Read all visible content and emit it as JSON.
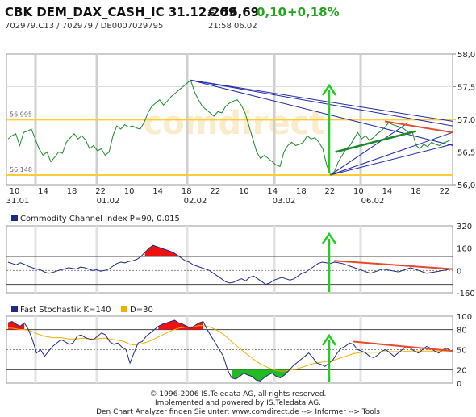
{
  "header": {
    "title": "CBK DEM_DAX_CASH_IC 31.12.209",
    "price": "€ 56,69",
    "change": "0,10",
    "change_pct": "+0,18%",
    "ids": "702979.C13  /  702979  /  DE0007029795",
    "time": "21:58   06.02"
  },
  "watermark": "comdirect",
  "footer": {
    "line1": "© 1996-2006 IS.Teledata AG, all rights reserved.",
    "line2": "Implemented and powered by IS.Teledata AG.",
    "line3": "Den Chart Analyzer finden Sie unter: www.comdirect.de --> Informer --> Tools"
  },
  "colors": {
    "price_line": "#1a8a2a",
    "trend_blue": "#1f2aa8",
    "trend_red": "#e64a2a",
    "support_orange": "#ffcc33",
    "arrow_green": "#22cc22",
    "fill_red": "#ee1111",
    "fill_green": "#22bb22",
    "indicator_line": "#1e2b82",
    "signal_line": "#f0b000"
  },
  "chart_data": [
    {
      "type": "line",
      "title": "",
      "ylim": [
        56.0,
        58.0
      ],
      "yticks": [
        "58,0",
        "57,5",
        "57,0",
        "56,5",
        "56,0"
      ],
      "x_ticks_top": [
        "10",
        "14",
        "18",
        "22",
        "10",
        "14",
        "18",
        "22",
        "10",
        "14",
        "18",
        "22",
        "10",
        "14",
        "18",
        "22"
      ],
      "x_ticks_bottom": [
        "31.01",
        "01.02",
        "02.02",
        "03.02",
        "06.02"
      ],
      "support_lines": [
        {
          "label": "56,995",
          "value": 56.995
        },
        {
          "label": "56,148",
          "value": 56.148
        }
      ],
      "series": [
        {
          "values": [
            56.7,
            56.75,
            56.78,
            56.6,
            56.8,
            56.82,
            56.85,
            56.7,
            56.55,
            56.45,
            56.5,
            56.35,
            56.42,
            56.5,
            56.48,
            56.65,
            56.72,
            56.78,
            56.7,
            56.75,
            56.68,
            56.55,
            56.6,
            56.52,
            56.55,
            56.45,
            56.5,
            56.75,
            56.9,
            56.85,
            56.92,
            56.88,
            56.9,
            56.87,
            56.85,
            56.95,
            57.1,
            57.2,
            57.25,
            57.3,
            57.22,
            57.28,
            57.35,
            57.4,
            57.45,
            57.5,
            57.55,
            57.6,
            57.42,
            57.3,
            57.2,
            57.15,
            57.1,
            57.05,
            57.12,
            57.1,
            57.2,
            57.25,
            57.28,
            57.3,
            57.22,
            57.1,
            56.9,
            56.7,
            56.5,
            56.4,
            56.45,
            56.4,
            56.35,
            56.3,
            56.28,
            56.5,
            56.6,
            56.65,
            56.6,
            56.62,
            56.65,
            56.75,
            56.7,
            56.72,
            56.65,
            56.55,
            56.3,
            56.15,
            56.2,
            56.35,
            56.45,
            56.55,
            56.6,
            56.7,
            56.8,
            56.7,
            56.75,
            56.68,
            56.72,
            56.78,
            56.82,
            56.88,
            56.95,
            56.92,
            56.9,
            56.88,
            56.85,
            56.8,
            56.82,
            56.6,
            56.55,
            56.62,
            56.58,
            56.65,
            56.62,
            56.6,
            56.64,
            56.66,
            56.69
          ]
        }
      ]
    },
    {
      "type": "line",
      "title": "Commodity Channel Index P=90, 0.015",
      "ylim": [
        -160,
        320
      ],
      "yticks": [
        "320",
        "160",
        "0",
        "-160"
      ],
      "series": [
        {
          "values": [
            60,
            50,
            40,
            55,
            45,
            30,
            20,
            10,
            5,
            -10,
            -20,
            -15,
            -5,
            5,
            10,
            20,
            15,
            10,
            25,
            20,
            10,
            0,
            5,
            -5,
            0,
            10,
            30,
            50,
            60,
            55,
            65,
            70,
            80,
            100,
            130,
            160,
            180,
            170,
            160,
            150,
            140,
            130,
            110,
            90,
            70,
            60,
            40,
            30,
            20,
            10,
            0,
            -20,
            -40,
            -60,
            -80,
            -90,
            -85,
            -70,
            -60,
            -75,
            -50,
            -40,
            -60,
            -80,
            -100,
            -90,
            -70,
            -60,
            -50,
            -60,
            -70,
            -60,
            -40,
            -20,
            -10,
            10,
            30,
            50,
            60,
            55,
            50,
            60,
            55,
            50,
            40,
            30,
            20,
            10,
            0,
            -10,
            -20,
            -10,
            0,
            10,
            5,
            0,
            -5,
            -10,
            0,
            10,
            20,
            10,
            0,
            -10,
            -20,
            -15,
            -10,
            -5,
            0,
            5,
            10
          ]
        }
      ]
    },
    {
      "type": "line",
      "title": "Fast Stochastik K=140",
      "legend": [
        "Fast Stochastik K=140",
        "D=30"
      ],
      "ylim": [
        0,
        100
      ],
      "yticks": [
        "100",
        "80",
        "50",
        "20",
        "0"
      ],
      "series": [
        {
          "name": "Fast Stochastik K=140",
          "values": [
            90,
            92,
            88,
            85,
            90,
            80,
            65,
            45,
            50,
            40,
            48,
            55,
            60,
            65,
            62,
            58,
            60,
            70,
            72,
            68,
            66,
            65,
            70,
            75,
            72,
            62,
            58,
            60,
            54,
            50,
            30,
            45,
            60,
            62,
            70,
            75,
            80,
            85,
            88,
            90,
            92,
            94,
            90,
            88,
            85,
            82,
            86,
            90,
            92,
            80,
            70,
            60,
            50,
            40,
            20,
            8,
            6,
            10,
            15,
            12,
            10,
            5,
            3,
            8,
            12,
            15,
            10,
            8,
            12,
            18,
            25,
            30,
            35,
            40,
            45,
            38,
            30,
            28,
            25,
            30,
            35,
            45,
            52,
            55,
            60,
            58,
            50,
            48,
            45,
            40,
            38,
            42,
            48,
            50,
            45,
            40,
            45,
            50,
            55,
            52,
            48,
            45,
            50,
            55,
            52,
            48,
            45,
            50,
            52,
            48
          ]
        },
        {
          "name": "D=30",
          "values": [
            82,
            82,
            81,
            80,
            80,
            79,
            77,
            74,
            72,
            70,
            69,
            68,
            68,
            68,
            67,
            66,
            66,
            66,
            67,
            67,
            66,
            66,
            66,
            67,
            67,
            66,
            65,
            64,
            63,
            61,
            58,
            57,
            58,
            59,
            61,
            63,
            66,
            69,
            72,
            75,
            78,
            80,
            82,
            83,
            84,
            84,
            85,
            86,
            86,
            85,
            83,
            80,
            77,
            73,
            68,
            62,
            57,
            52,
            47,
            42,
            38,
            33,
            29,
            26,
            23,
            21,
            19,
            18,
            18,
            19,
            20,
            21,
            23,
            25,
            27,
            29,
            30,
            31,
            32,
            33,
            34,
            36,
            38,
            40,
            42,
            44,
            45,
            46,
            46,
            46,
            46,
            46,
            47,
            47,
            47,
            47,
            47,
            47,
            48,
            48,
            48,
            48,
            48,
            48,
            48,
            48,
            48,
            48,
            48,
            48
          ]
        }
      ]
    }
  ]
}
